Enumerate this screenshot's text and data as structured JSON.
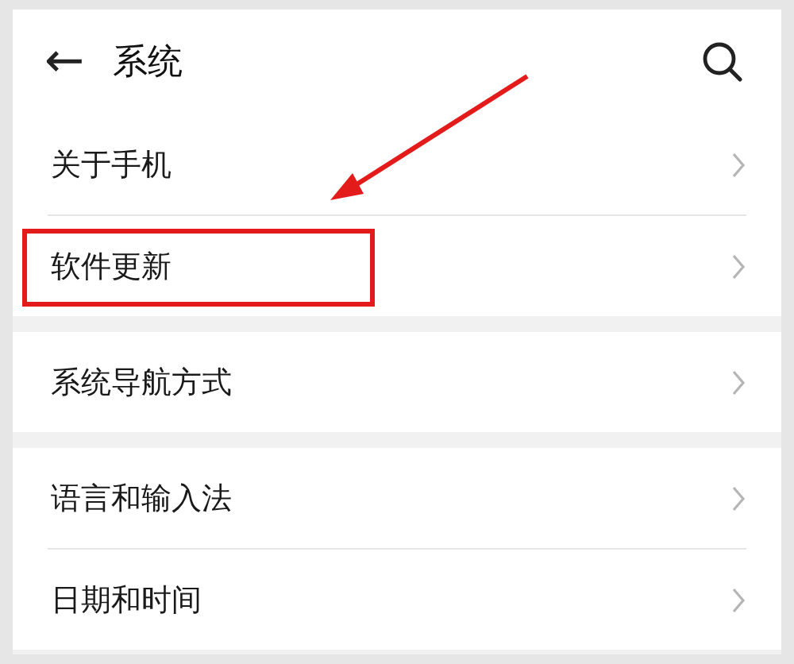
{
  "header": {
    "back": "←",
    "title": "系统"
  },
  "groups": [
    {
      "items": [
        {
          "label": "关于手机",
          "highlighted": false
        },
        {
          "label": "软件更新",
          "highlighted": true
        }
      ]
    },
    {
      "items": [
        {
          "label": "系统导航方式",
          "highlighted": false
        }
      ]
    },
    {
      "items": [
        {
          "label": "语言和输入法",
          "highlighted": false
        },
        {
          "label": "日期和时间",
          "highlighted": false
        }
      ]
    }
  ]
}
